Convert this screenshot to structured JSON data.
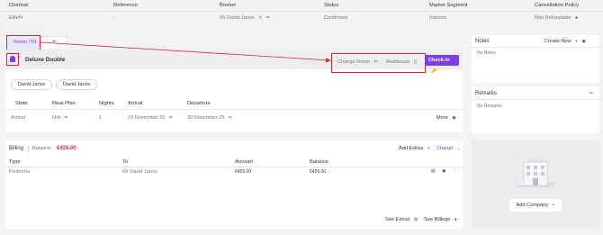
{
  "top_table": {
    "headers": [
      "Channel",
      "Reference",
      "Booker",
      "Status",
      "Market Segment",
      "Cancellation Policy"
    ],
    "row": {
      "channel": "ElliefV",
      "reference": "-",
      "booker": "Mr David Jarvis",
      "status": "Confirmed",
      "market_segment": "Internet",
      "cancellation_policy": "Non Refundable"
    }
  },
  "room_tabs": {
    "active": "Room 701",
    "add": "+"
  },
  "room": {
    "title": "Deluxe Double",
    "change_room": "Change Room",
    "reallocate": "Reallocate",
    "check_in": "Check-In"
  },
  "guests": [
    "David Jarvis",
    "David Jarvis"
  ],
  "stay_table": {
    "headers": [
      "State",
      "Meal Plan",
      "Nights",
      "Arrival",
      "Departure"
    ],
    "row": {
      "state": "Arrival",
      "meal_plan": "N/A",
      "nights": "1",
      "arrival": "29 November 25",
      "departure": "30 November 25",
      "more": "More"
    }
  },
  "notes": {
    "title": "Notes",
    "create_new": "Create New",
    "empty": "No Notes"
  },
  "remarks": {
    "title": "Remarks",
    "empty": "No Remarks"
  },
  "billing": {
    "title": "Billing",
    "balance_label": "Balance:",
    "balance_value": "€426.00",
    "add_extras": "Add Extras",
    "charge": "Charge",
    "headers": [
      "Type",
      "To",
      "Amount",
      "Balance"
    ],
    "row": {
      "type": "Proforma",
      "to": "Mr David Jarvis",
      "amount": "€426.00",
      "balance": "€426.00"
    },
    "see_extras": "See Extras",
    "see_billings": "See Billings"
  },
  "company": {
    "add_company": "Add Company"
  },
  "colors": {
    "accent": "#7b3fe4",
    "annotation": "#e0242c",
    "balance": "#e0245e"
  }
}
